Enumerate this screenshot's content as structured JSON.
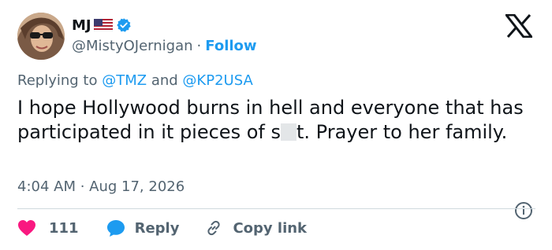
{
  "author": {
    "name": "MJ",
    "handle": "@MistyOJernigan",
    "separator": "·",
    "follow_label": "Follow"
  },
  "reply_context": {
    "prefix": "Replying to",
    "mention_1": "@TMZ",
    "conjunction": "and",
    "mention_2": "@KP2USA"
  },
  "tweet": {
    "text_part_1": "I hope Hollywood burns in hell and everyone that has participated in it pieces of s",
    "text_part_2": "t. Prayer to her family.",
    "timestamp": "4:04 AM · Aug 17, 2026"
  },
  "actions": {
    "like_count": "111",
    "reply_label": "Reply",
    "copy_link_label": "Copy link"
  },
  "colors": {
    "accent": "#1d9bf0",
    "like": "#f91880",
    "secondary_text": "#536471",
    "divider": "#cfd9de"
  },
  "icons": {
    "verified": "verified-badge-icon",
    "flag": "us-flag-icon",
    "logo": "x-logo-icon",
    "info": "info-icon",
    "like": "heart-icon",
    "reply": "speech-bubble-icon",
    "copy_link": "link-icon"
  }
}
